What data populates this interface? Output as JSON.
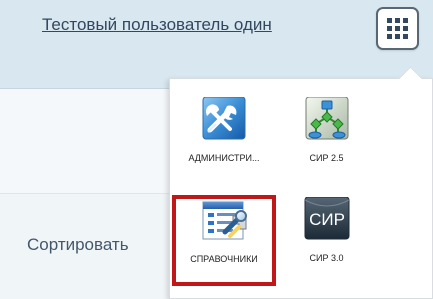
{
  "header": {
    "user_name": "Тестовый пользователь один"
  },
  "content": {
    "sort_label": "Сортировать"
  },
  "apps": [
    {
      "label": "АДМИНИСТРИ...",
      "icon": "admin-tools-icon"
    },
    {
      "label": "СИР 2.5",
      "icon": "network-diagram-icon"
    },
    {
      "label": "СПРАВОЧНИКИ",
      "icon": "directory-book-icon"
    },
    {
      "label": "СИР 3.0",
      "icon": "cir-dark-icon",
      "badge": "СИР"
    }
  ],
  "colors": {
    "highlight": "#c01818",
    "header": "#d9e7f1",
    "text": "#33475d"
  }
}
